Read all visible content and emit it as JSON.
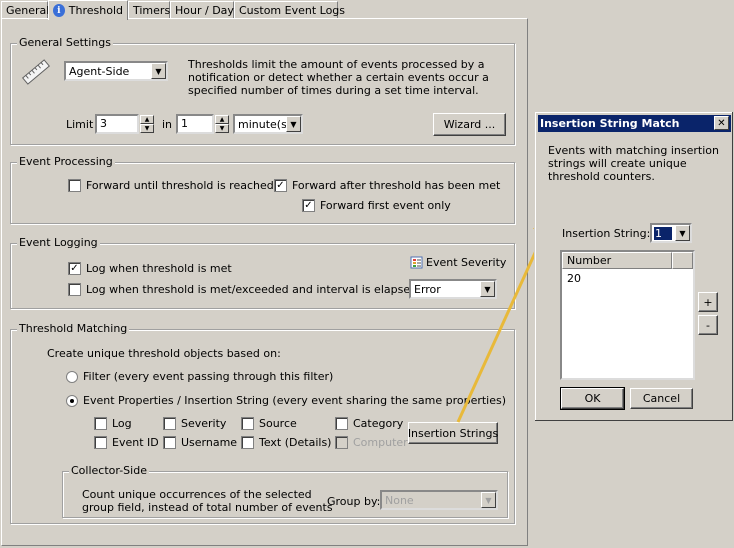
{
  "tabs": [
    {
      "label": "General"
    },
    {
      "label": "Threshold"
    },
    {
      "label": "Timers"
    },
    {
      "label": "Hour / Day"
    },
    {
      "label": "Custom Event Logs"
    }
  ],
  "general_settings": {
    "title": "General Settings",
    "mode_value": "Agent-Side",
    "description": "Thresholds limit the amount of events processed by a notification or detect whether a certain events occur a specified number of times during a set time interval.",
    "limit_label": "Limit",
    "limit_value": "3",
    "in_label": "in",
    "in_value": "1",
    "unit_value": "minute(s)",
    "wizard_label": "Wizard ..."
  },
  "event_processing": {
    "title": "Event Processing",
    "forward_until": {
      "label": "Forward until threshold is reached",
      "checked": false
    },
    "forward_after": {
      "label": "Forward after threshold has been met",
      "checked": true
    },
    "forward_first": {
      "label": "Forward first event only",
      "checked": true
    }
  },
  "event_logging": {
    "title": "Event Logging",
    "log_met": {
      "label": "Log when threshold is met",
      "checked": true
    },
    "log_exceeded": {
      "label": "Log when threshold is met/exceeded and interval is elapsed",
      "checked": false
    },
    "severity_label": "Event Severity",
    "severity_value": "Error"
  },
  "threshold_matching": {
    "title": "Threshold Matching",
    "intro": "Create unique threshold objects based on:",
    "radio_filter": {
      "label": "Filter (every event passing through this filter)",
      "selected": false
    },
    "radio_props": {
      "label": "Event Properties / Insertion String (every event sharing the same properties)",
      "selected": true
    },
    "checks": {
      "log": "Log",
      "severity": "Severity",
      "source": "Source",
      "category": "Category",
      "event_id": "Event ID",
      "username": "Username",
      "text": "Text (Details)",
      "computer": "Computer"
    },
    "insertion_strings_button": "Insertion Strings",
    "collector": {
      "title": "Collector-Side",
      "description_line1": "Count unique occurrences of the selected",
      "description_line2": "group field, instead of total number of events",
      "group_by_label": "Group by:",
      "group_by_value": "None"
    }
  },
  "dialog": {
    "title": "Insertion String Match",
    "description": "Events with matching insertion strings will create unique threshold counters.",
    "insertion_string_label": "Insertion String:",
    "insertion_string_value": "1",
    "column_header": "Number",
    "rows": [
      "20"
    ],
    "add_label": "+",
    "remove_label": "-",
    "ok_label": "OK",
    "cancel_label": "Cancel"
  },
  "colors": {
    "titlebar": "#0a246a",
    "arrow": "#e8b93a",
    "face": "#d4d0c8"
  }
}
